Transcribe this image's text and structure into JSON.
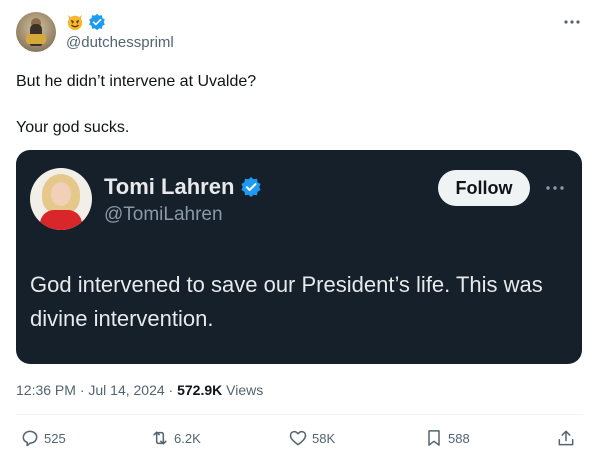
{
  "author": {
    "emoji_name": "smiling-devil-emoji",
    "handle": "@dutchesspriml"
  },
  "post": {
    "line1": "But he didn’t intervene at Uvalde?",
    "line2": "Your god sucks."
  },
  "embedded": {
    "name": "Tomi Lahren",
    "handle": "@TomiLahren",
    "follow_label": "Follow",
    "text": "God intervened to save our President’s life. This was divine intervention."
  },
  "meta": {
    "time_date": "12:36 PM · Jul 14, 2024 · ",
    "views_count": "572.9K",
    "views_label": " Views"
  },
  "actions": {
    "replies": "525",
    "reposts": "6.2K",
    "likes": "58K",
    "bookmarks": "588"
  },
  "colors": {
    "verified": "#1d9bf0",
    "embed_bg": "#15202b",
    "secondary_text": "#536471"
  }
}
